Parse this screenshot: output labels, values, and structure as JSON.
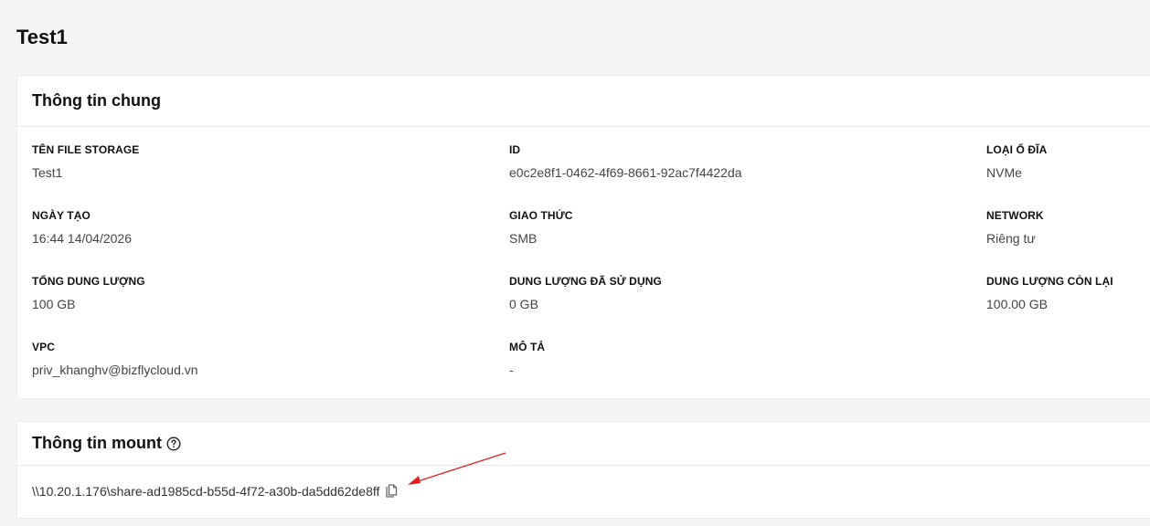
{
  "page": {
    "title": "Test1"
  },
  "general": {
    "title": "Thông tin chung",
    "fields": [
      {
        "label": "TÊN FILE STORAGE",
        "value": "Test1"
      },
      {
        "label": "ID",
        "value": "e0c2e8f1-0462-4f69-8661-92ac7f4422da"
      },
      {
        "label": "LOẠI Ổ ĐĨA",
        "value": "NVMe"
      },
      {
        "label": "NGÀY TẠO",
        "value": "16:44 14/04/2026"
      },
      {
        "label": "GIAO THỨC",
        "value": "SMB"
      },
      {
        "label": "NETWORK",
        "value": "Riêng tư"
      },
      {
        "label": "TỔNG DUNG LƯỢNG",
        "value": "100 GB"
      },
      {
        "label": "DUNG LƯỢNG ĐÃ SỬ DỤNG",
        "value": "0 GB"
      },
      {
        "label": "DUNG LƯỢNG CÒN LẠI",
        "value": "100.00 GB"
      },
      {
        "label": "VPC",
        "value": "priv_khanghv@bizflycloud.vn"
      },
      {
        "label": "MÔ TẢ",
        "value": "-"
      }
    ]
  },
  "mount": {
    "title": "Thông tin mount",
    "path": "\\\\10.20.1.176\\share-ad1985cd-b55d-4f72-a30b-da5dd62de8ff"
  },
  "colors": {
    "annotation_arrow": "#e02020"
  },
  "icons": {
    "help": "question-circle-icon",
    "copy": "copy-icon"
  }
}
